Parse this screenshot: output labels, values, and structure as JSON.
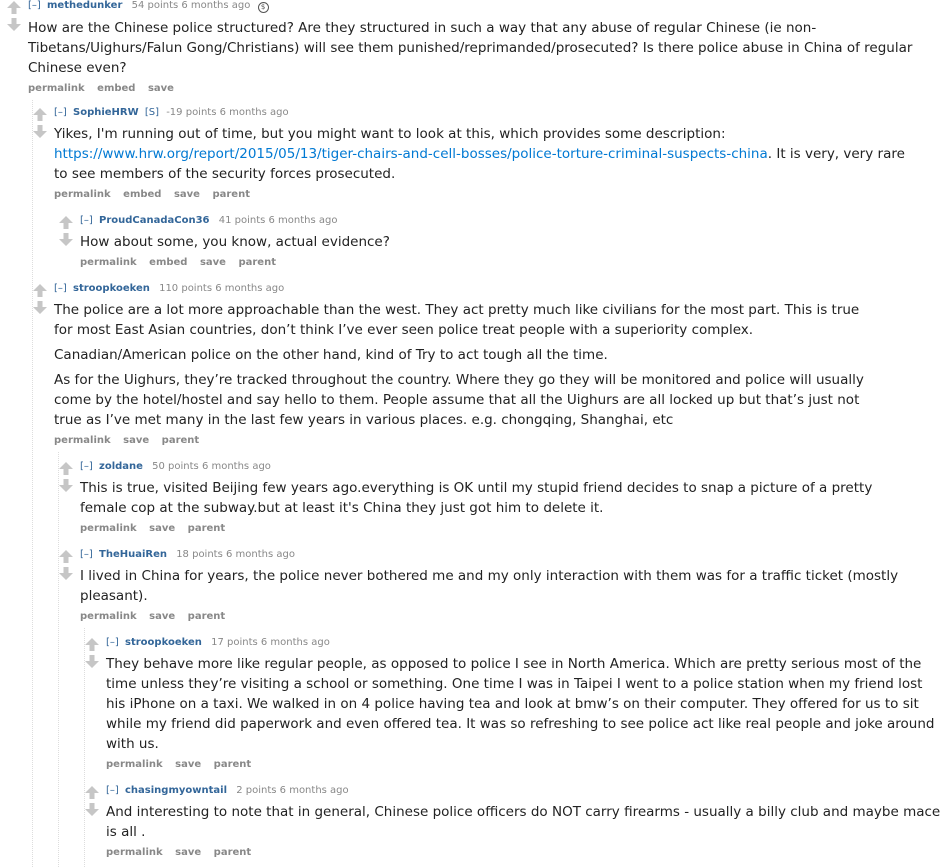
{
  "gold_label": "$",
  "comments": [
    {
      "expand": "[–]",
      "author": "methedunker",
      "submitter": "",
      "score": "54 points",
      "age": "6 months ago",
      "gilded": true,
      "paragraphs": [
        "How are the Chinese police structured? Are they structured in such a way that any abuse of regular Chinese (ie non-Tibetans/Uighurs/Falun Gong/Christians) will see them punished/reprimanded/prosecuted? Is there police abuse in China of regular Chinese even?"
      ],
      "buttons": [
        "permalink",
        "embed",
        "save"
      ]
    },
    {
      "expand": "[–]",
      "author": "SophieHRW",
      "submitter": "[S]",
      "score": "-19 points",
      "age": "6 months ago",
      "paragraphs": [
        "Yikes, I'm running out of time, but you might want to look at this, which provides some description:"
      ],
      "link": "https://www.hrw.org/report/2015/05/13/tiger-chairs-and-cell-bosses/police-torture-criminal-suspects-china",
      "link_suffix": ". It is very, very rare to see members of the security forces prosecuted.",
      "buttons": [
        "permalink",
        "embed",
        "save",
        "parent"
      ]
    },
    {
      "expand": "[–]",
      "author": "ProudCanadaCon36",
      "submitter": "",
      "score": "41 points",
      "age": "6 months ago",
      "paragraphs": [
        "How about some, you know, actual evidence?"
      ],
      "buttons": [
        "permalink",
        "embed",
        "save",
        "parent"
      ]
    },
    {
      "expand": "[–]",
      "author": "stroopkoeken",
      "submitter": "",
      "score": "110 points",
      "age": "6 months ago",
      "paragraphs": [
        "The police are a lot more approachable than the west. They act pretty much like civilians for the most part. This is true for most East Asian countries, don’t think I’ve ever seen police treat people with a superiority complex.",
        "Canadian/American police on the other hand, kind of Try to act tough all the time.",
        "As for the Uighurs, they’re tracked throughout the country. Where they go they will be monitored and police will usually come by the hotel/hostel and say hello to them. People assume that all the Uighurs are all locked up but that’s just not true as I’ve met many in the last few years in various places. e.g. chongqing, Shanghai, etc"
      ],
      "buttons": [
        "permalink",
        "save",
        "parent"
      ]
    },
    {
      "expand": "[–]",
      "author": "zoldane",
      "submitter": "",
      "score": "50 points",
      "age": "6 months ago",
      "paragraphs": [
        "This is true, visited Beijing few years ago.everything is OK until my stupid friend decides to snap a picture of a pretty female cop at the subway.but at least it's China they just got him to delete it."
      ],
      "buttons": [
        "permalink",
        "save",
        "parent"
      ]
    },
    {
      "expand": "[–]",
      "author": "TheHuaiRen",
      "submitter": "",
      "score": "18 points",
      "age": "6 months ago",
      "paragraphs": [
        "I lived in China for years, the police never bothered me and my only interaction with them was for a traffic ticket (mostly pleasant)."
      ],
      "buttons": [
        "permalink",
        "save",
        "parent"
      ]
    },
    {
      "expand": "[–]",
      "author": "stroopkoeken",
      "submitter": "",
      "score": "17 points",
      "age": "6 months ago",
      "paragraphs": [
        "They behave more like regular people, as opposed to police I see in North America. Which are pretty serious most of the time unless they’re visiting a school or something. One time I was in Taipei I went to a police station when my friend lost his iPhone on a taxi. We walked in on 4 police having tea and look at bmw’s on their computer. They offered for us to sit while my friend did paperwork and even offered tea. It was so refreshing to see police act like real people and joke around with us."
      ],
      "buttons": [
        "permalink",
        "save",
        "parent"
      ]
    },
    {
      "expand": "[–]",
      "author": "chasingmyowntail",
      "submitter": "",
      "score": "2 points",
      "age": "6 months ago",
      "paragraphs": [
        "And interesting to note that in general, Chinese police officers do NOT carry firearms - usually a billy club and maybe mace is all ."
      ],
      "buttons": [
        "permalink",
        "save",
        "parent"
      ]
    }
  ]
}
